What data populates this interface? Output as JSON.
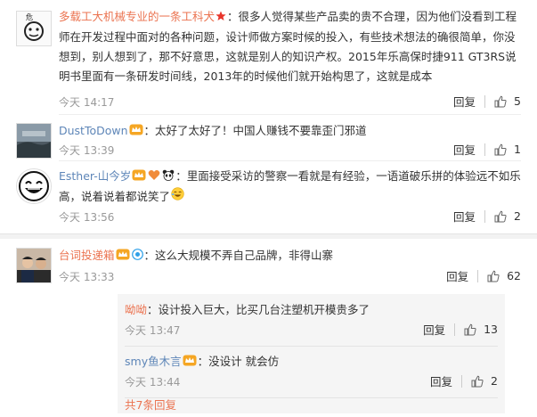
{
  "comments": [
    {
      "user": "多载工大机械专业的一条工科犬",
      "text": "：很多人觉得某些产品卖的贵不合理，因为他们没看到工程师在开发过程中面对的各种问题，设计师做方案时候的投入，有些技术想法的确很简单，你没想到，别人想到了，那不好意思，这就是别人的知识产权。2015年乐高保时捷911 GT3RS说明书里面有一条研发时间线，2013年的时候他们就开始构思了，这就是成本",
      "time": "今天 14:17",
      "reply": "回复",
      "likes": "5"
    },
    {
      "user": "DustToDown",
      "text": "：太好了太好了！中国人赚钱不要靠歪门邪道",
      "time": "今天 13:39",
      "reply": "回复",
      "likes": "1"
    },
    {
      "user": "Esther-山今岁",
      "text": "：里面接受采访的警察一看就是有经验，一语道破乐拼的体验远不如乐高，说着说着都说笑了",
      "time": "今天 13:56",
      "reply": "回复",
      "likes": "2"
    },
    {
      "user": "台词投递箱",
      "text": "：这么大规模不弄自己品牌，非得山寨",
      "time": "今天 13:33",
      "reply": "回复",
      "likes": "62",
      "replies": [
        {
          "user": "呦呦",
          "text": "：设计投入巨大，比买几台注塑机开模贵多了",
          "time": "今天 13:47",
          "reply": "回复",
          "likes": "13"
        },
        {
          "user": "smy鱼木言",
          "text": "：没设计 就会仿",
          "time": "今天 13:44",
          "reply": "回复",
          "likes": "2"
        }
      ],
      "more": "共7条回复"
    }
  ],
  "colors": {
    "username": "#eb7350",
    "link": "#5e86b8",
    "meta": "#999999"
  },
  "icons": {
    "like": "thumbs-up-icon",
    "vip": "crown-badge-icon",
    "star": "star-badge-icon"
  }
}
